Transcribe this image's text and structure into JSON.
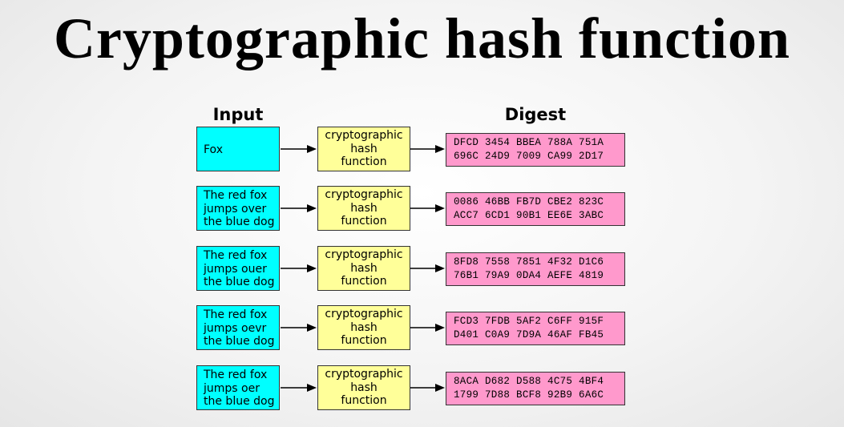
{
  "title": "Cryptographic hash function",
  "headers": {
    "input": "Input",
    "digest": "Digest"
  },
  "rows": [
    {
      "input": "Fox",
      "function": "cryptographic\nhash\nfunction",
      "digest": "DFCD 3454 BBEA 788A 751A\n696C 24D9 7009 CA99 2D17"
    },
    {
      "input": "The red fox\njumps over\nthe blue dog",
      "function": "cryptographic\nhash\nfunction",
      "digest": "0086 46BB FB7D CBE2 823C\nACC7 6CD1 90B1 EE6E 3ABC"
    },
    {
      "input": "The red fox\njumps ouer\nthe blue dog",
      "function": "cryptographic\nhash\nfunction",
      "digest": "8FD8 7558 7851 4F32 D1C6\n76B1 79A9 0DA4 AEFE 4819"
    },
    {
      "input": "The red fox\njumps oevr\nthe blue dog",
      "function": "cryptographic\nhash\nfunction",
      "digest": "FCD3 7FDB 5AF2 C6FF 915F\nD401 C0A9 7D9A 46AF FB45"
    },
    {
      "input": "The red fox\njumps oer\nthe blue dog",
      "function": "cryptographic\nhash\nfunction",
      "digest": "8ACA D682 D588 4C75 4BF4\n1799 7D88 BCF8 92B9 6A6C"
    }
  ]
}
